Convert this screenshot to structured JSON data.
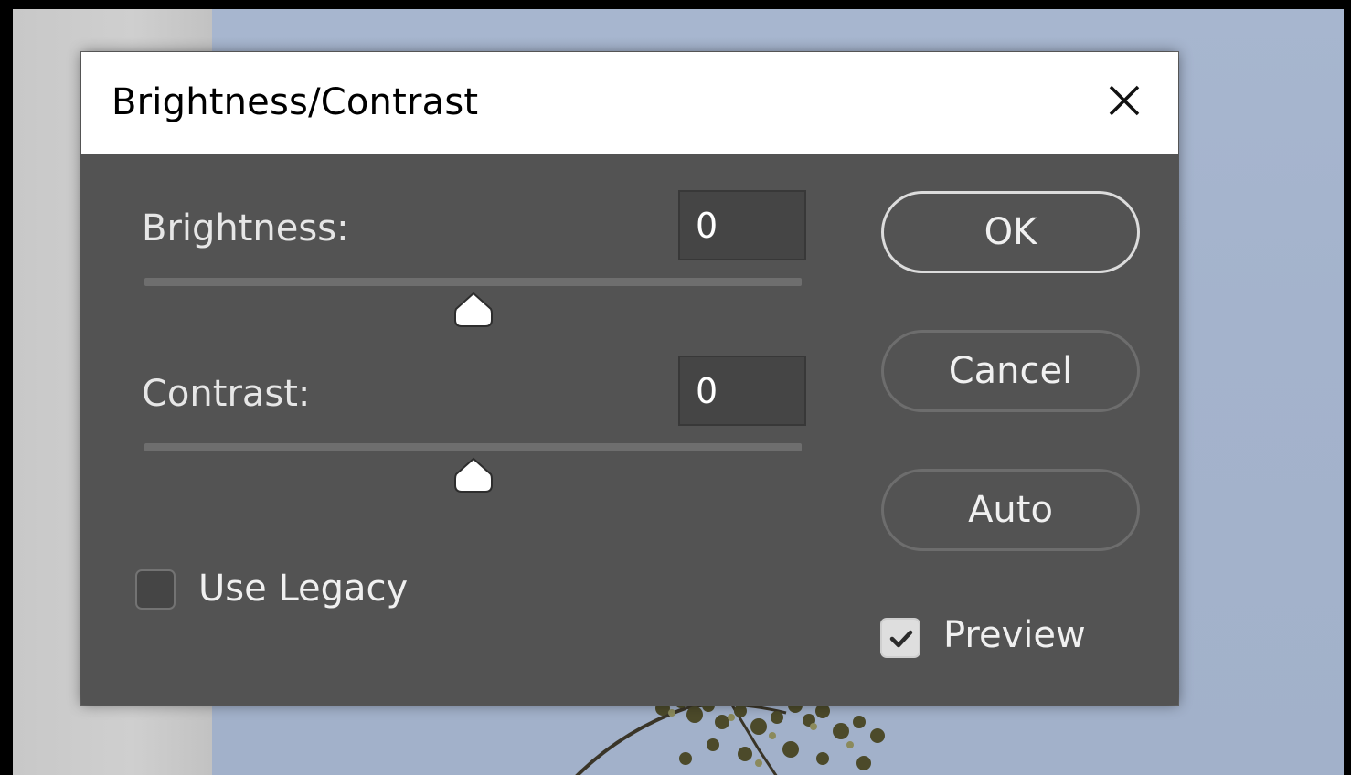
{
  "dialog": {
    "title": "Brightness/Contrast",
    "close_icon": "close-icon"
  },
  "brightness": {
    "label": "Brightness:",
    "value": "0",
    "slider_fraction": 0.5
  },
  "contrast": {
    "label": "Contrast:",
    "value": "0",
    "slider_fraction": 0.5
  },
  "buttons": {
    "ok": "OK",
    "cancel": "Cancel",
    "auto": "Auto"
  },
  "options": {
    "use_legacy": {
      "label": "Use Legacy",
      "checked": false
    },
    "preview": {
      "label": "Preview",
      "checked": true
    }
  },
  "colors": {
    "dialog_bg": "#535353",
    "title_bar": "#ffffff",
    "input_bg": "#454545",
    "canvas_sky": "#a7b6cf"
  }
}
